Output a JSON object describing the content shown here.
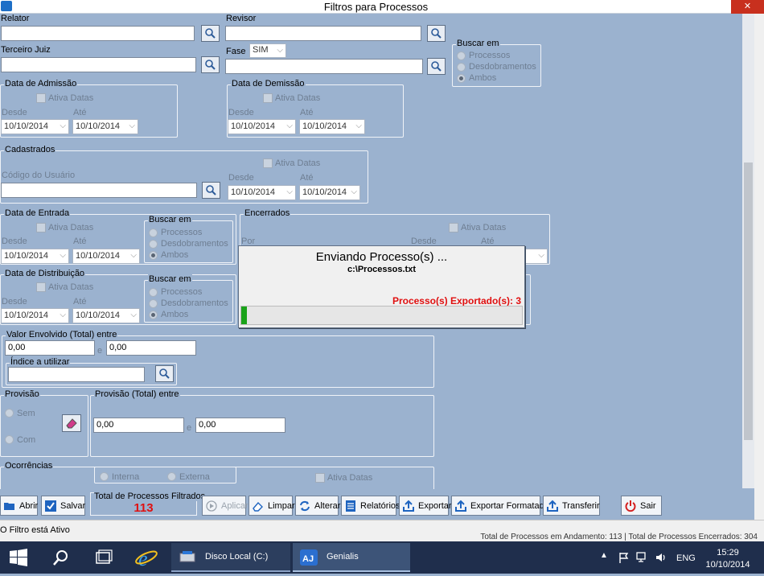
{
  "window": {
    "title": "Filtros para Processos",
    "close_label": "✕"
  },
  "labels": {
    "relator": "Relator",
    "revisor": "Revisor",
    "terceiro_juiz": "Terceiro Juiz",
    "fase": "Fase",
    "fase_value": "SIM",
    "buscar_em": "Buscar em",
    "processos": "Processos",
    "desdobramentos": "Desdobramentos",
    "ambos": "Ambos",
    "ativa_datas": "Ativa Datas",
    "desde": "Desde",
    "ate": "Até",
    "data_admissao": "Data de Admissão",
    "data_demissao": "Data de Demissão",
    "cadastrados": "Cadastrados",
    "codigo_usuario": "Código do Usuário",
    "data_entrada": "Data de Entrada",
    "encerrados": "Encerrados",
    "por": "Por",
    "data_distribuicao": "Data de Distribuição",
    "valor_envolvido": "Valor Envolvido (Total) entre",
    "e": "e",
    "indice": "Índice a utilizar",
    "provisao": "Provisão",
    "sem": "Sem",
    "com": "Com",
    "provisao_total": "Provisão (Total) entre",
    "ocorrencias": "Ocorrências",
    "interna": "Interna",
    "externa": "Externa"
  },
  "dates": {
    "d": "10/10/2014"
  },
  "values": {
    "valor_from": "0,00",
    "valor_to": "0,00",
    "prov_from": "0,00",
    "prov_to": "0,00"
  },
  "dialog": {
    "title": "Enviando Processo(s) ...",
    "file": "c:\\Processos.txt",
    "status": "Processo(s) Exportado(s): 3",
    "progress": 0.02
  },
  "total": {
    "label": "Total de Processos Filtrados",
    "value": "113"
  },
  "toolbar": {
    "abrir": "Abrir",
    "salvar": "Salvar",
    "aplicar": "Aplicar",
    "limpar": "Limpar",
    "alterar": "Alterar",
    "relatorios": "Relatórios",
    "exportar": "Exportar",
    "exportar_formatado": "Exportar Formatado",
    "transferir": "Transferir",
    "sair": "Sair"
  },
  "status": {
    "left": "O Filtro está Ativo",
    "right": "Total de Processos em Andamento: 113   |   Total de Processos Encerrados: 304"
  },
  "taskbar": {
    "disco": "Disco Local (C:)",
    "genialis": "Genialis",
    "lang": "ENG",
    "time": "15:29",
    "date": "10/10/2014"
  },
  "colors": {
    "form_bg": "#9bb2cf",
    "accent_red": "#e01010",
    "progress_green": "#1aa31a",
    "taskbar": "#1f2e4c"
  }
}
